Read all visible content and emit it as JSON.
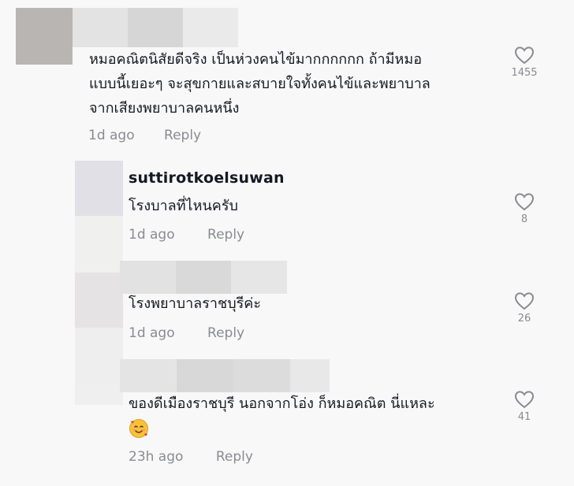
{
  "comments": [
    {
      "lines": [
        "หมอคณิตนิสัยดีจริง เป็นห่วงคนไข้มากกกกกก ถ้ามีหมอ",
        "แบบนี้เยอะๆ จะสุขกายและสบายใจทั้งคนไข้และพยาบาล",
        "จากเสียงพยาบาลคนหนึ่ง"
      ],
      "time": "1d ago",
      "reply": "Reply",
      "likes": "1455"
    },
    {
      "username": "suttirotkoelsuwan",
      "lines": [
        "โรงบาลที่ไหนครับ"
      ],
      "time": "1d ago",
      "reply": "Reply",
      "likes": "8"
    },
    {
      "lines": [
        "โรงพยาบาลราชบุรีค่ะ"
      ],
      "time": "1d ago",
      "reply": "Reply",
      "likes": "26"
    },
    {
      "lines": [
        "ของดีเมืองราชบุรี นอกจากโอ่ง ก็หมอคณิต นี่แหละ"
      ],
      "emoji": "smiling-face-with-hearts",
      "time": "23h ago",
      "reply": "Reply",
      "likes": "41"
    }
  ],
  "colors": {
    "text": "#161823",
    "meta": "#8a8b91",
    "background": "#f8f8f8"
  }
}
